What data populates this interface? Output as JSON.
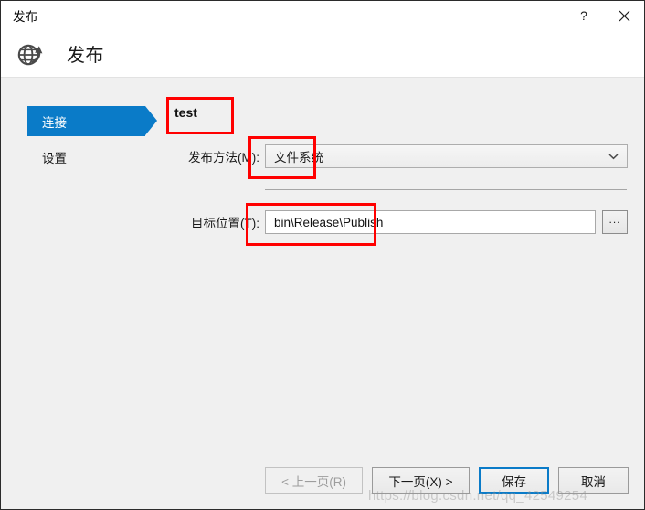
{
  "window": {
    "title": "发布",
    "help_button": "?",
    "close_button": "✕",
    "help_icon_name": "help-icon",
    "close_icon_name": "close-icon"
  },
  "header": {
    "title": "发布",
    "icon": "globe-publish-icon"
  },
  "sidebar": {
    "items": [
      {
        "label": "连接",
        "selected": true
      },
      {
        "label": "设置",
        "selected": false
      }
    ]
  },
  "main": {
    "profile_name": "test",
    "fields": [
      {
        "label": "发布方法(M):",
        "type": "combobox",
        "value": "文件系统",
        "arrow_icon": "chevron-down-icon"
      },
      {
        "label": "目标位置(T):",
        "type": "text",
        "value": "bin\\Release\\Publish",
        "browse_label": "..."
      }
    ]
  },
  "footer": {
    "buttons": [
      {
        "label": "< 上一页(R)",
        "state": "disabled"
      },
      {
        "label": "下一页(X) >",
        "state": "normal"
      },
      {
        "label": "保存",
        "state": "focused"
      },
      {
        "label": "取消",
        "state": "normal"
      }
    ]
  },
  "annotations": {
    "accent_color": "#ff0000",
    "boxes": [
      "profile-name",
      "publish-method-value",
      "target-location-value"
    ]
  },
  "watermark": {
    "text": "https://blog.csdn.net/qq_42549254"
  },
  "colors": {
    "selection_blue": "#0a7bc8",
    "dialog_bg": "#f0f0f0",
    "header_bg": "#ffffff",
    "annotation_red": "#ff0000"
  }
}
